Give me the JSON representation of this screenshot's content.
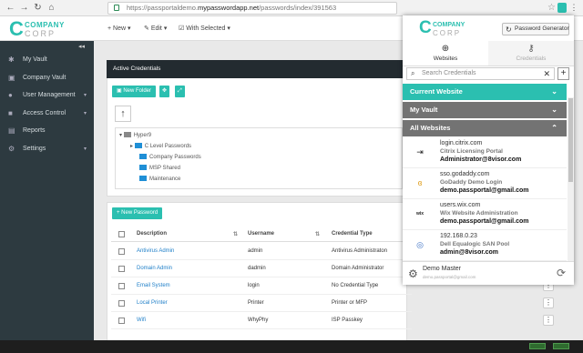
{
  "browser": {
    "url_prefix": "https://passportaldemo.",
    "url_domain": "mypasswordapp.net",
    "url_path": "/passwords/index/391563"
  },
  "logo": {
    "letter": "C",
    "line1": "COMPANY",
    "line2": "CORP"
  },
  "toolbar": {
    "new_label": "New",
    "edit_label": "Edit",
    "with_selected_label": "With Selected"
  },
  "sidebar": {
    "items": [
      {
        "label": "My Vault",
        "icon": "asterisk-icon"
      },
      {
        "label": "Company Vault",
        "icon": "vault-icon"
      },
      {
        "label": "User Management",
        "icon": "user-icon"
      },
      {
        "label": "Access Control",
        "icon": "lock-icon"
      },
      {
        "label": "Reports",
        "icon": "chart-icon"
      },
      {
        "label": "Settings",
        "icon": "gears-icon"
      }
    ]
  },
  "credentials_panel": {
    "title": "Active Credentials",
    "new_folder_label": "New Folder",
    "tree": {
      "root": "Hyper9",
      "folders": [
        "C Level Passwords",
        "Company Passwords",
        "MSP Shared",
        "Maintenance"
      ]
    }
  },
  "table": {
    "new_password_label": "New Password",
    "headers": {
      "description": "Description",
      "username": "Username",
      "credential_type": "Credential Type"
    },
    "rows": [
      {
        "description": "Antivirus Admin",
        "username": "admin",
        "type": "Antivirus Administraton"
      },
      {
        "description": "Domain Admin",
        "username": "dadmin",
        "type": "Domain Administrator"
      },
      {
        "description": "Email System",
        "username": "login",
        "type": "No Credential Type"
      },
      {
        "description": "Local Printer",
        "username": "Printer",
        "type": "Printer or MFP"
      },
      {
        "description": "Wifi",
        "username": "WhyPhy",
        "type": "ISP Passkey"
      }
    ]
  },
  "popup": {
    "generator_label": "Password Generator",
    "tabs": {
      "websites": "Websites",
      "credentials": "Credentials"
    },
    "search_placeholder": "Search Credentials",
    "sections": {
      "current": "Current Website",
      "vault": "My Vault",
      "all": "All Websites"
    },
    "accent_color": "#2bbfb0",
    "section_gray": "#737373",
    "entries": [
      {
        "url": "login.citrix.com",
        "name": "Citrix Licensing Portal",
        "user": "Administrator@8visor.com",
        "icon": "citrix-icon"
      },
      {
        "url": "sso.godaddy.com",
        "name": "GoDaddy Demo Login",
        "user": "demo.passportal@gmail.com",
        "icon": "godaddy-icon"
      },
      {
        "url": "users.wix.com",
        "name": "Wix Website Administration",
        "user": "demo.passportal@gmail.com",
        "icon": "wix-icon"
      },
      {
        "url": "192.168.0.23",
        "name": "Dell Equalogic SAN Pool",
        "user": "admin@8visor.com",
        "icon": "dell-icon"
      }
    ],
    "footer": {
      "name": "Demo Master",
      "email": "demo.passportal@gmail.com"
    }
  }
}
